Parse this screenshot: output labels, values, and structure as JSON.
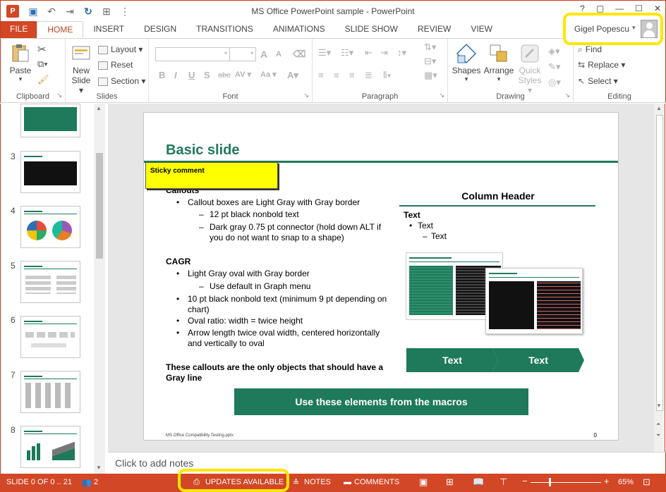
{
  "window": {
    "title": "MS Office PowerPoint sample - PowerPoint",
    "app_logo": "P",
    "controls": [
      "?",
      "▢",
      "—",
      "☐",
      "✕"
    ]
  },
  "qat": [
    "save-icon",
    "undo-icon",
    "redo-icon",
    "repeat-icon",
    "customize-icon"
  ],
  "tabs": [
    "FILE",
    "HOME",
    "INSERT",
    "DESIGN",
    "TRANSITIONS",
    "ANIMATIONS",
    "SLIDE SHOW",
    "REVIEW",
    "VIEW"
  ],
  "user": {
    "name": "Gigel Popescu",
    "caret": "▾"
  },
  "ribbon": {
    "clipboard": {
      "label": "Clipboard",
      "paste": "Paste"
    },
    "slides": {
      "label": "Slides",
      "new_slide_1": "New",
      "new_slide_2": "Slide ▾",
      "layout": "Layout ▾",
      "reset": "Reset",
      "section": "Section ▾"
    },
    "font": {
      "label": "Font",
      "bold": "B",
      "italic": "I",
      "underline": "U",
      "strike": "S",
      "abc": "abc",
      "av": "AV ▾",
      "aa": "Aa ▾",
      "grow": "A",
      "shrink": "A"
    },
    "paragraph": {
      "label": "Paragraph"
    },
    "drawing": {
      "label": "Drawing",
      "shapes": "Shapes",
      "arrange": "Arrange",
      "quick_styles_1": "Quick",
      "quick_styles_2": "Styles ▾"
    },
    "editing": {
      "label": "Editing",
      "find": "Find",
      "replace": "Replace ▾",
      "select": "Select ▾"
    }
  },
  "thumbnails": [
    {
      "num": "3"
    },
    {
      "num": "4"
    },
    {
      "num": "5"
    },
    {
      "num": "6"
    },
    {
      "num": "7"
    },
    {
      "num": "8"
    }
  ],
  "slide": {
    "title": "Basic slide",
    "sticky": "Sticky comment",
    "callouts_head": "Callouts",
    "callouts_b1": "Callout boxes are Light Gray with Gray border",
    "callouts_s1": "12 pt black nonbold text",
    "callouts_s2a": "Dark gray 0.75 pt connector (hold down ALT if",
    "callouts_s2b": "you do not want to snap to a shape)",
    "cagr_head": "CAGR",
    "cagr_b1": "Light Gray oval with Gray border",
    "cagr_s1": "Use default in Graph menu",
    "cagr_b2a": "10 pt black nonbold text (minimum 9 pt depending on",
    "cagr_b2b": "chart)",
    "cagr_b3": "Oval ratio: width = twice height",
    "cagr_b4a": "Arrow length twice oval width, centered horizontally",
    "cagr_b4b": "and vertically to oval",
    "closing_a": "These callouts are the only objects that should have a",
    "closing_b": "Gray line",
    "col_header": "Column Header",
    "col_text_head": "Text",
    "col_text_b1": "Text",
    "col_text_s1": "Text",
    "chevron_1": "Text",
    "chevron_2": "Text",
    "macro_button": "Use these elements from the macros",
    "footer": "MS Office Compatibility Testing.pptx",
    "page_num": "0"
  },
  "notes": {
    "placeholder": "Click to add notes"
  },
  "status": {
    "slide_info": "SLIDE 0 OF 0 .. 21",
    "authors": "2",
    "updates": "UPDATES AVAILABLE",
    "notes": "NOTES",
    "comments": "COMMENTS",
    "zoom_minus": "−",
    "zoom_plus": "+",
    "zoom": "65%"
  },
  "colors": {
    "accent": "#d24726",
    "brand_green": "#1e7a5a",
    "highlight": "#ffe600"
  }
}
